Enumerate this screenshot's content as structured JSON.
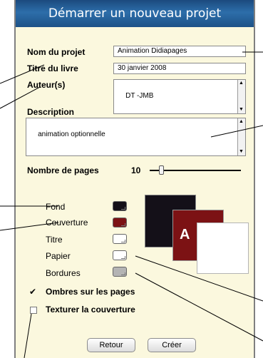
{
  "dialog": {
    "title": "Démarrer un nouveau projet"
  },
  "form": {
    "project_name_label": "Nom du projet",
    "project_name_value": "Animation Didiapages",
    "book_title_label": "Titre du livre",
    "book_title_value": "30 janvier 2008",
    "authors_label": "Auteur(s)",
    "authors_value": "DT -JMB",
    "description_label": "Description",
    "description_value": "animation optionnelle",
    "pages_label": "Nombre de pages",
    "pages_value": "10",
    "pages_slider_level": 0.1
  },
  "colors": {
    "items": [
      {
        "label": "Fond",
        "color": "#141018"
      },
      {
        "label": "Couverture",
        "color": "#7c1214"
      },
      {
        "label": "Titre",
        "color": "#ffffff"
      },
      {
        "label": "Papier",
        "color": "#ffffff"
      },
      {
        "label": "Bordures",
        "color": "#b4b4b4"
      }
    ],
    "preview_cover_letter": "A"
  },
  "options": {
    "shadows_label": "Ombres sur les pages",
    "shadows_checked": true,
    "texture_label": "Texturer la couverture",
    "texture_checked": false
  },
  "buttons": {
    "back": "Retour",
    "create": "Créer"
  }
}
